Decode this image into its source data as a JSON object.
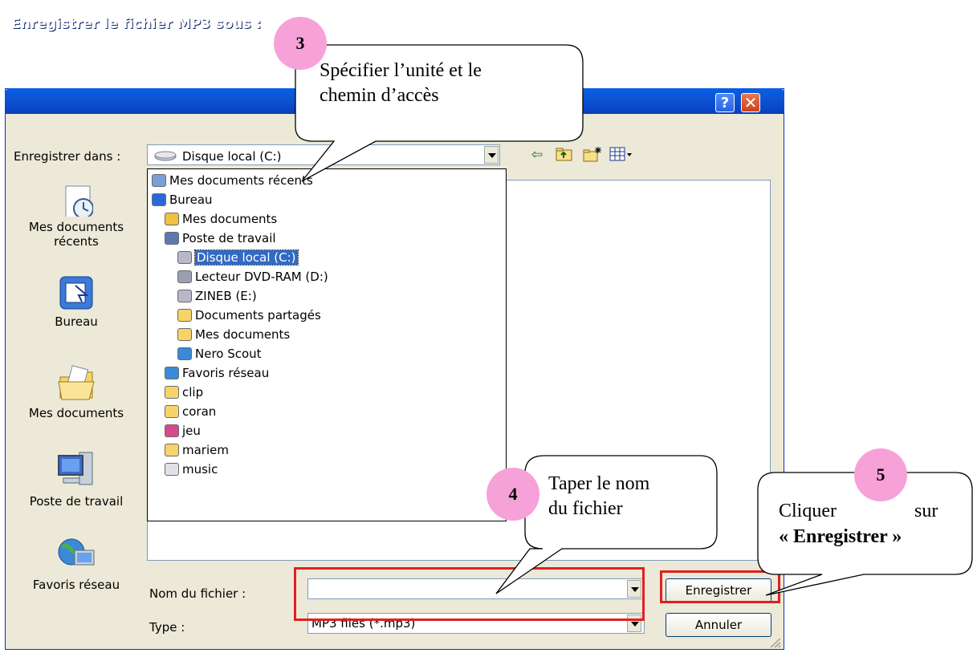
{
  "window": {
    "title": "Enregistrer le fichier MP3 sous :",
    "help_glyph": "?",
    "close_glyph": "✕"
  },
  "toolbar": {
    "save_in_label": "Enregistrer dans :",
    "current_location": "Disque local (C:)",
    "icons": [
      "back-icon",
      "up-folder-icon",
      "new-folder-icon",
      "views-menu-icon"
    ]
  },
  "places": [
    {
      "label": "Mes documents récents",
      "icon": "recent-documents-icon"
    },
    {
      "label": "Bureau",
      "icon": "desktop-icon"
    },
    {
      "label": "Mes documents",
      "icon": "my-documents-icon"
    },
    {
      "label": "Poste de travail",
      "icon": "my-computer-icon"
    },
    {
      "label": "Favoris réseau",
      "icon": "network-places-icon"
    }
  ],
  "location_dropdown": {
    "items": [
      {
        "label": "Mes documents récents",
        "level": 0,
        "icon": "recent-documents-icon"
      },
      {
        "label": "Bureau",
        "level": 0,
        "icon": "desktop-icon"
      },
      {
        "label": "Mes documents",
        "level": 1,
        "icon": "my-documents-icon"
      },
      {
        "label": "Poste de travail",
        "level": 1,
        "icon": "my-computer-icon"
      },
      {
        "label": "Disque local (C:)",
        "level": 2,
        "icon": "hard-drive-icon",
        "selected": true
      },
      {
        "label": "Lecteur DVD-RAM (D:)",
        "level": 2,
        "icon": "dvd-drive-icon"
      },
      {
        "label": "ZINEB (E:)",
        "level": 2,
        "icon": "hard-drive-icon"
      },
      {
        "label": "Documents partagés",
        "level": 2,
        "icon": "folder-icon"
      },
      {
        "label": "Mes documents",
        "level": 2,
        "icon": "folder-icon"
      },
      {
        "label": "Nero Scout",
        "level": 2,
        "icon": "nero-scout-icon"
      },
      {
        "label": "Favoris réseau",
        "level": 1,
        "icon": "network-places-icon"
      },
      {
        "label": "clip",
        "level": 1,
        "icon": "folder-icon"
      },
      {
        "label": "coran",
        "level": 1,
        "icon": "folder-icon"
      },
      {
        "label": "jeu",
        "level": 1,
        "icon": "game-icon"
      },
      {
        "label": "mariem",
        "level": 1,
        "icon": "folder-icon"
      },
      {
        "label": "music",
        "level": 1,
        "icon": "music-icon"
      }
    ]
  },
  "form": {
    "filename_label": "Nom du fichier :",
    "filename_value": "",
    "type_label": "Type :",
    "type_value": "MP3 files (*.mp3)",
    "save_button": "Enregistrer",
    "cancel_button": "Annuler"
  },
  "callouts": [
    {
      "number": "3",
      "lines": [
        "Spécifier l’unité et le",
        "chemin d’accès"
      ]
    },
    {
      "number": "4",
      "lines": [
        "Taper le nom",
        "du fichier"
      ]
    },
    {
      "number": "5",
      "lines": [
        "Cliquer",
        "sur"
      ],
      "bold_line": "« Enregistrer »"
    }
  ],
  "colors": {
    "titlebar": "#0b55d4",
    "dialog_bg": "#ece9d8",
    "selection": "#316ac5",
    "highlight_red": "#e02020",
    "badge_pink": "#f6a2d8"
  }
}
